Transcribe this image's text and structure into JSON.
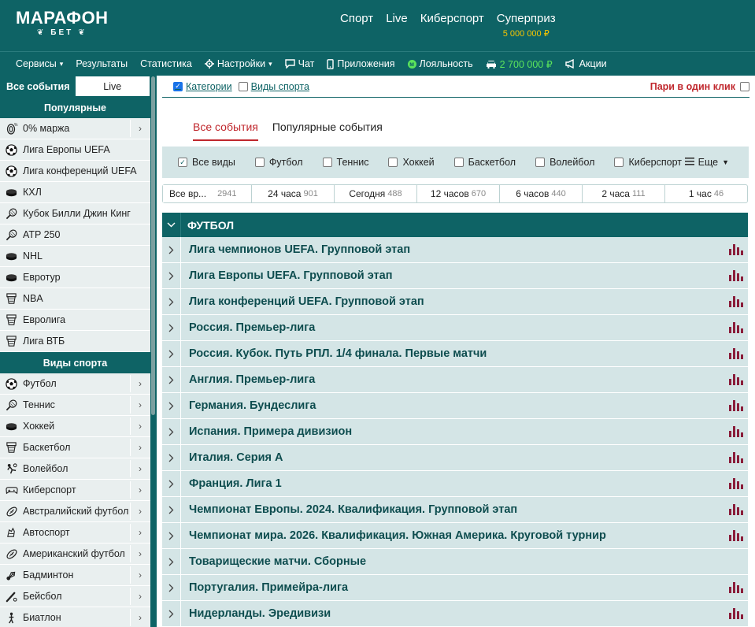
{
  "header": {
    "logo_main": "МАРАФОН",
    "logo_sub": "БЕТ",
    "nav": [
      "Спорт",
      "Live",
      "Киберспорт"
    ],
    "superprize_label": "Суперприз",
    "superprize_amount": "5 000 000 ₽"
  },
  "subnav": {
    "services": "Сервисы",
    "results": "Результаты",
    "statistics": "Статистика",
    "settings": "Настройки",
    "chat": "Чат",
    "apps": "Приложения",
    "loyalty": "Лояльность",
    "car_prize": "2 700 000 ₽",
    "promos": "Акции"
  },
  "sidebar": {
    "tabs": [
      "Все события",
      "Live"
    ],
    "popular_title": "Популярные",
    "popular": [
      {
        "label": "0% маржа",
        "icon": "percent-icon",
        "arrow": true
      },
      {
        "label": "Лига Европы UEFA",
        "icon": "football-icon",
        "arrow": false
      },
      {
        "label": "Лига конференций UEFA",
        "icon": "football-icon",
        "arrow": false
      },
      {
        "label": "КХЛ",
        "icon": "hockey-puck-icon",
        "arrow": false
      },
      {
        "label": "Кубок Билли Джин Кинг",
        "icon": "tennis-icon",
        "arrow": false
      },
      {
        "label": "ATP 250",
        "icon": "tennis-icon",
        "arrow": false
      },
      {
        "label": "NHL",
        "icon": "hockey-puck-icon",
        "arrow": false
      },
      {
        "label": "Евротур",
        "icon": "hockey-puck-icon",
        "arrow": false
      },
      {
        "label": "NBA",
        "icon": "basketball-icon",
        "arrow": false
      },
      {
        "label": "Евролига",
        "icon": "basketball-icon",
        "arrow": false
      },
      {
        "label": "Лига ВТБ",
        "icon": "basketball-icon",
        "arrow": false
      }
    ],
    "sports_title": "Виды спорта",
    "sports": [
      {
        "label": "Футбол",
        "icon": "football-icon"
      },
      {
        "label": "Теннис",
        "icon": "tennis-icon"
      },
      {
        "label": "Хоккей",
        "icon": "hockey-puck-icon"
      },
      {
        "label": "Баскетбол",
        "icon": "basketball-icon"
      },
      {
        "label": "Волейбол",
        "icon": "volleyball-icon"
      },
      {
        "label": "Киберспорт",
        "icon": "gamepad-icon"
      },
      {
        "label": "Австралийский футбол",
        "icon": "rugby-ball-icon"
      },
      {
        "label": "Автоспорт",
        "icon": "car-icon"
      },
      {
        "label": "Американский футбол",
        "icon": "rugby-ball-icon"
      },
      {
        "label": "Бадминтон",
        "icon": "shuttlecock-icon"
      },
      {
        "label": "Бейсбол",
        "icon": "baseball-icon"
      },
      {
        "label": "Биатлон",
        "icon": "biathlon-icon"
      }
    ]
  },
  "main": {
    "categories_label": "Категории",
    "sports_types_label": "Виды спорта",
    "one_click_label": "Пари в один клик",
    "event_tabs": [
      "Все события",
      "Популярные события"
    ],
    "filters": [
      "Все виды",
      "Футбол",
      "Теннис",
      "Хоккей",
      "Баскетбол",
      "Волейбол",
      "Киберспорт"
    ],
    "more_label": "Еще",
    "time_filters": [
      {
        "label": "Все вр...",
        "count": "2941"
      },
      {
        "label": "24 часа",
        "count": "901"
      },
      {
        "label": "Сегодня",
        "count": "488"
      },
      {
        "label": "12 часов",
        "count": "670"
      },
      {
        "label": "6 часов",
        "count": "440"
      },
      {
        "label": "2 часа",
        "count": "111"
      },
      {
        "label": "1 час",
        "count": "46"
      }
    ],
    "section_title": "ФУТБОЛ",
    "leagues": [
      {
        "name": "Лига чемпионов UEFA. Групповой этап",
        "stats": true
      },
      {
        "name": "Лига Европы UEFA. Групповой этап",
        "stats": true
      },
      {
        "name": "Лига конференций UEFA. Групповой этап",
        "stats": true
      },
      {
        "name": "Россия. Премьер-лига",
        "stats": true
      },
      {
        "name": "Россия. Кубок. Путь РПЛ. 1/4 финала. Первые матчи",
        "stats": true
      },
      {
        "name": "Англия. Премьер-лига",
        "stats": true
      },
      {
        "name": "Германия. Бундеслига",
        "stats": true
      },
      {
        "name": "Испания. Примера дивизион",
        "stats": true
      },
      {
        "name": "Италия. Серия А",
        "stats": true
      },
      {
        "name": "Франция. Лига 1",
        "stats": true
      },
      {
        "name": "Чемпионат Европы. 2024. Квалификация. Групповой этап",
        "stats": true
      },
      {
        "name": "Чемпионат мира. 2026. Квалификация. Южная Америка. Круговой турнир",
        "stats": true
      },
      {
        "name": "Товарищеские матчи. Сборные",
        "stats": false
      },
      {
        "name": "Португалия. Примейра-лига",
        "stats": true
      },
      {
        "name": "Нидерланды. Эредивизи",
        "stats": true
      }
    ]
  },
  "colors": {
    "brand": "#0e6365",
    "accent_red": "#c0272d",
    "gold": "#f6c500",
    "green": "#5be45b",
    "row_bg": "#d4e5e6",
    "stats_bar": "#8a1d3a"
  }
}
